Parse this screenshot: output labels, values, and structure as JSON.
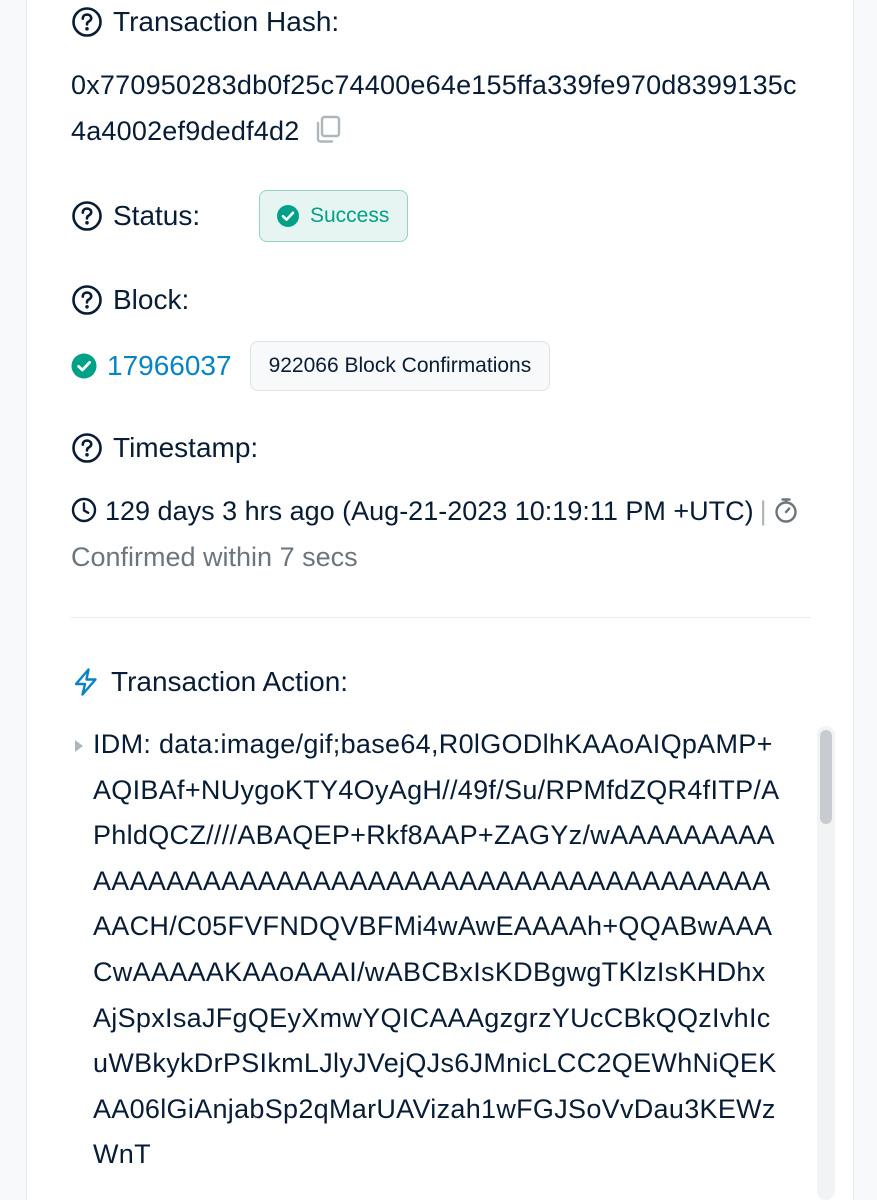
{
  "transaction_hash": {
    "label": "Transaction Hash:",
    "value": "0x770950283db0f25c74400e64e155ffa339fe970d8399135c4a4002ef9dedf4d2",
    "icon": "copy-icon"
  },
  "status": {
    "label": "Status:",
    "badge": "Success",
    "color": "#00a186"
  },
  "block": {
    "label": "Block:",
    "number": "17966037",
    "confirmations": "922066 Block Confirmations"
  },
  "timestamp": {
    "label": "Timestamp:",
    "age": "129 days 3 hrs ago (Aug-21-2023 10:19:11 PM +UTC)",
    "separator": "|",
    "confirmed": "Confirmed within 7 secs"
  },
  "transaction_action": {
    "label": "Transaction Action:",
    "text": "IDM: data:image/gif;base64,R0lGODlhKAAoAIQpAMP+AQIBAf+NUygoKTY4OyAgH//49f/Su/RPMfdZQR4fITP/APhldQCZ////ABAQEP+Rkf8AAP+ZAGYz/wAAAAAAAAAAAAAAAAAAAAAAAAAAAAAAAAAAAAAAAAAAAAAAAACH/C05FVFNDQVBFMi4wAwEAAAAh+QQABwAAACwAAAAAKAAoAAAI/wABCBxIsKDBgwgTKlzIsKHDhxAjSpxIsaJFgQEyXmwYQICAAAgzgrzYUcCBkQQzIvhIcuWBkykDrPSIkmLJlyJVejQJs6JMnicLCC2QEWhNiQEKAA06lGiAnjabSp2qMarUAVizah1wFGJSoVvDau3KEWzWnT"
  },
  "colors": {
    "accent": "#0784c3",
    "text": "#081d35",
    "muted": "#6c757d",
    "success": "#00a186"
  }
}
